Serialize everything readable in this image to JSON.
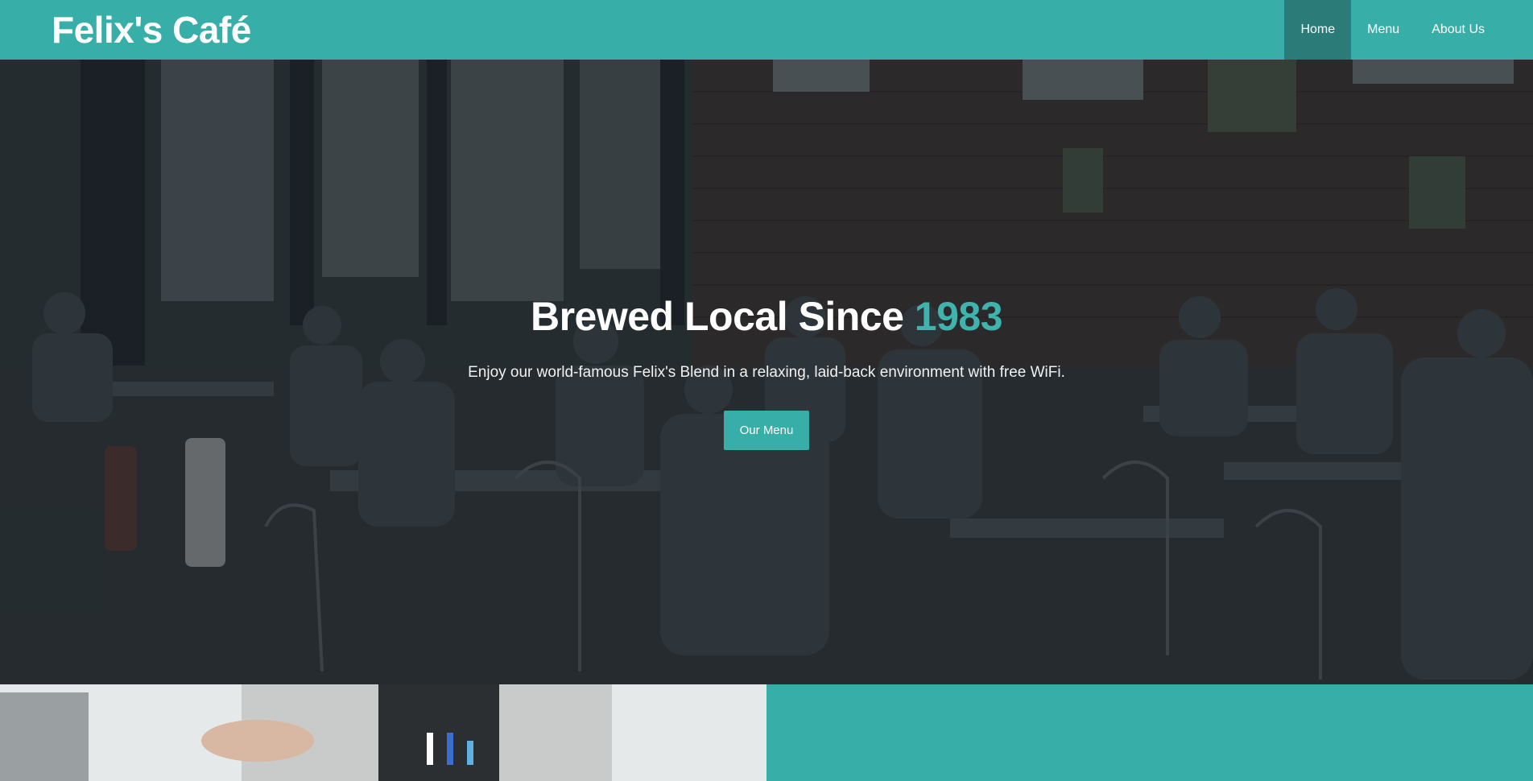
{
  "brand": {
    "name": "Felix's Café"
  },
  "nav": {
    "items": [
      {
        "label": "Home",
        "active": true
      },
      {
        "label": "Menu",
        "active": false
      },
      {
        "label": "About Us",
        "active": false
      }
    ]
  },
  "hero": {
    "title_main": "Brewed Local Since ",
    "title_accent": "1983",
    "subtitle": "Enjoy our world-famous Felix's Blend in a relaxing, laid-back environment with free WiFi.",
    "button_label": "Our Menu"
  },
  "colors": {
    "primary": "#38aea9",
    "primary_dark": "#2b7c79",
    "accent_text": "#3fb3ad"
  }
}
